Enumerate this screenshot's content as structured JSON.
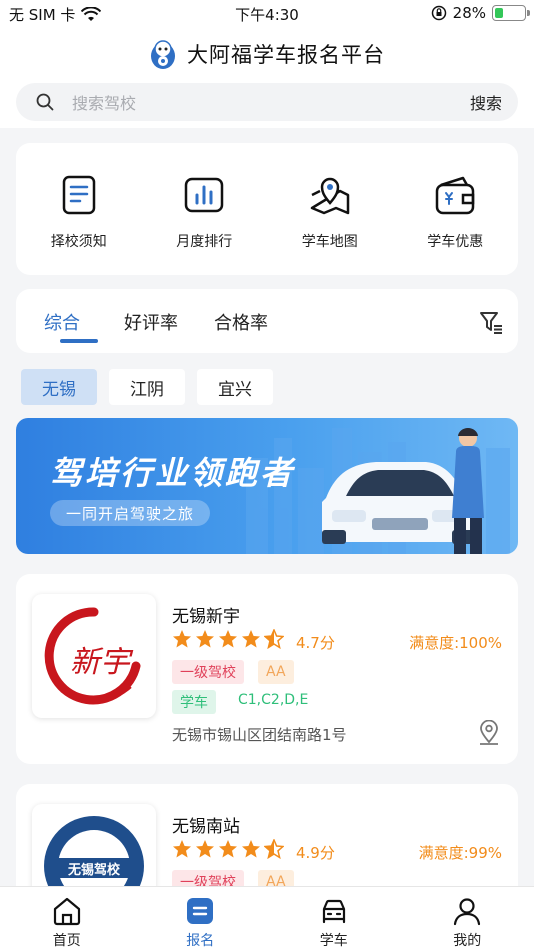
{
  "status_bar": {
    "carrier": "无 SIM 卡",
    "time": "下午4:30",
    "battery": "28%",
    "battery_level": 0.28
  },
  "header": {
    "title": "大阿福学车报名平台"
  },
  "search": {
    "placeholder": "搜索驾校",
    "button": "搜索"
  },
  "quick_links": [
    {
      "label": "择校须知",
      "icon": "document-icon"
    },
    {
      "label": "月度排行",
      "icon": "bar-chart-icon"
    },
    {
      "label": "学车地图",
      "icon": "map-icon"
    },
    {
      "label": "学车优惠",
      "icon": "wallet-icon"
    }
  ],
  "sort_tabs": [
    "综合",
    "好评率",
    "合格率"
  ],
  "cities": [
    "无锡",
    "江阴",
    "宜兴"
  ],
  "banner": {
    "headline": "驾培行业领跑者",
    "subline": "一同开启驾驶之旅"
  },
  "schools": [
    {
      "name": "无锡新宇",
      "rating": 4.5,
      "score": "4.7分",
      "satisfaction": "满意度:100%",
      "tags": [
        "一级驾校",
        "AA"
      ],
      "category": "学车",
      "licenses": "C1,C2,D,E",
      "address": "无锡市锡山区团结南路1号",
      "logo_text": "新宇"
    },
    {
      "name": "无锡南站",
      "rating": 4.5,
      "score": "4.9分",
      "satisfaction": "满意度:99%",
      "tags": [
        "一级驾校",
        "AA"
      ],
      "logo_text": "无锡驾校"
    }
  ],
  "tabbar": [
    {
      "label": "首页",
      "icon": "home-icon"
    },
    {
      "label": "报名",
      "icon": "signup-icon"
    },
    {
      "label": "学车",
      "icon": "car-icon"
    },
    {
      "label": "我的",
      "icon": "profile-icon"
    }
  ],
  "colors": {
    "accent": "#2f6fc4",
    "rating": "#f28c1b",
    "background": "#f4f5f7"
  }
}
